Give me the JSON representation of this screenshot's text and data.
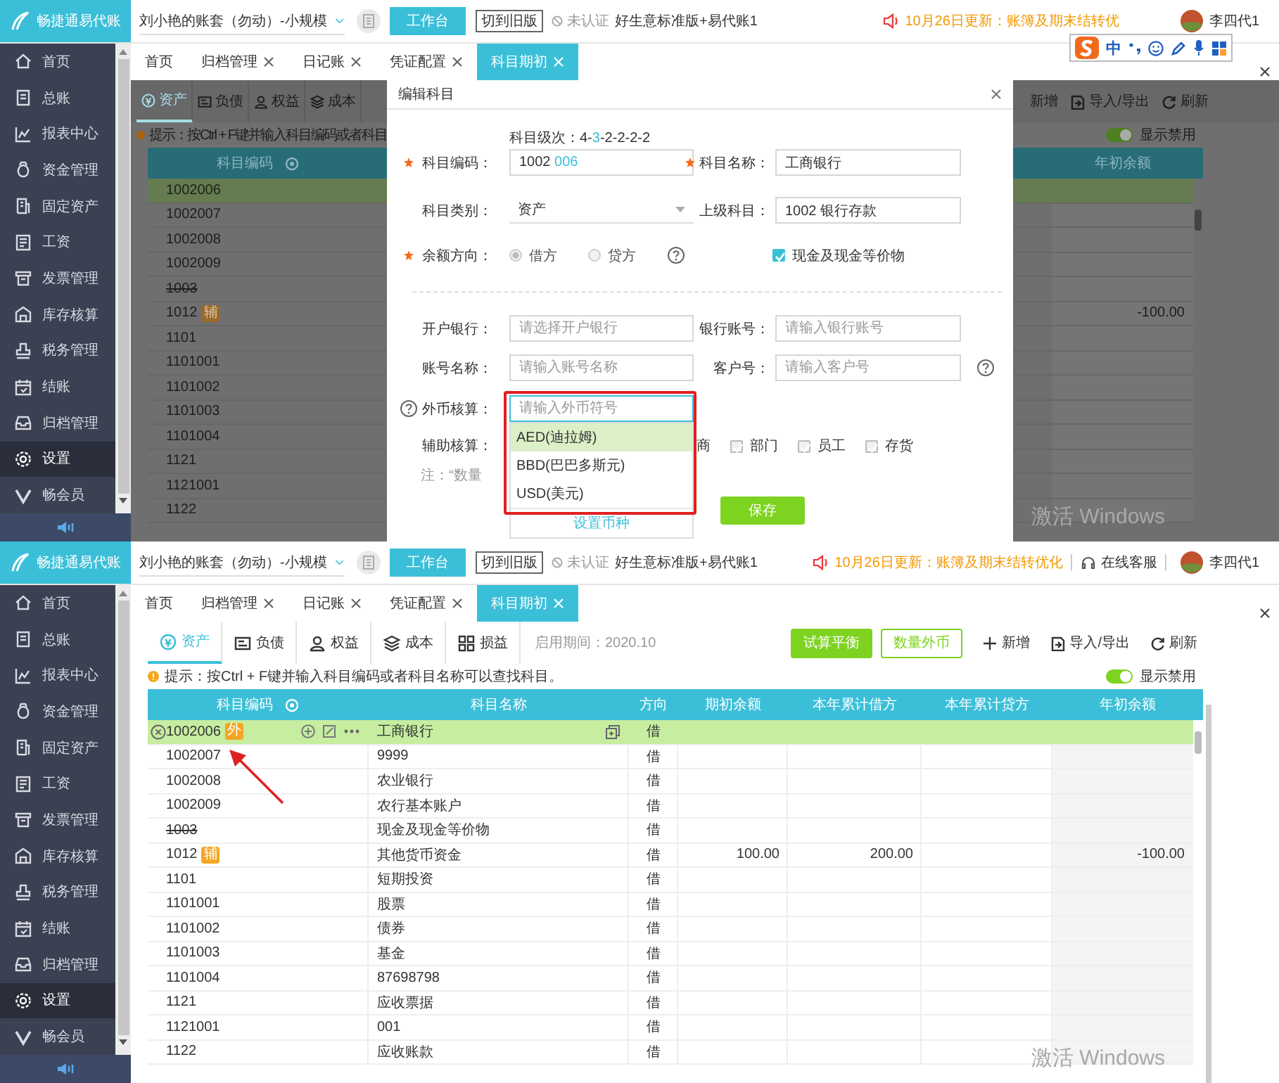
{
  "panels": [
    {
      "kind": "edit",
      "header": {
        "brand": "畅捷通易代账",
        "account": "刘小艳的账套（勿动）-小规模",
        "workbench": "工作台",
        "old_version": "切到旧版",
        "auth": "未认证",
        "edition": "好生意标准版+易代账1",
        "notice": "10月26日更新：账簿及期末结转优",
        "user": "李四代1"
      },
      "sidebar": [
        {
          "label": "首页",
          "selected": false
        },
        {
          "label": "总账",
          "selected": false
        },
        {
          "label": "报表中心",
          "selected": false
        },
        {
          "label": "资金管理",
          "selected": false
        },
        {
          "label": "固定资产",
          "selected": false
        },
        {
          "label": "工资",
          "selected": false
        },
        {
          "label": "发票管理",
          "selected": false
        },
        {
          "label": "库存核算",
          "selected": false
        },
        {
          "label": "税务管理",
          "selected": false
        },
        {
          "label": "结账",
          "selected": false
        },
        {
          "label": "归档管理",
          "selected": false
        },
        {
          "label": "设置",
          "selected": true
        },
        {
          "label": "畅会员",
          "selected": false
        }
      ],
      "tabs": [
        {
          "label": "首页",
          "closable": false,
          "selected": false
        },
        {
          "label": "归档管理",
          "closable": true,
          "selected": false
        },
        {
          "label": "日记账",
          "closable": true,
          "selected": false
        },
        {
          "label": "凭证配置",
          "closable": true,
          "selected": false
        },
        {
          "label": "科目期初",
          "closable": true,
          "selected": true
        }
      ],
      "ime": {
        "mode": "中"
      },
      "subtabs": [
        {
          "label": "资产",
          "selected": true
        },
        {
          "label": "负债",
          "selected": false
        },
        {
          "label": "权益",
          "selected": false
        },
        {
          "label": "成本",
          "selected": false
        }
      ],
      "hint": "提示：按Ctrl + F键并输入科目编码或者科目",
      "code_header": "科目编码",
      "actions": [
        {
          "label": "新增",
          "kind": "plain"
        },
        {
          "label": "导入/导出",
          "kind": "import"
        },
        {
          "label": "刷新",
          "kind": "refresh"
        }
      ],
      "toggle": {
        "label": "显示禁用",
        "on": true
      },
      "year_header": "年初余额",
      "rows": [
        {
          "code": "1002006",
          "selected": true,
          "disabled": false
        },
        {
          "code": "1002007",
          "selected": false,
          "disabled": false
        },
        {
          "code": "1002008",
          "selected": false,
          "disabled": false
        },
        {
          "code": "1002009",
          "selected": false,
          "disabled": false
        },
        {
          "code": "1003",
          "selected": false,
          "disabled": true
        },
        {
          "code": "1012",
          "badge": "辅",
          "selected": false,
          "disabled": false,
          "year_start": "-100.00"
        },
        {
          "code": "1101",
          "selected": false,
          "disabled": false
        },
        {
          "code": "1101001",
          "selected": false,
          "disabled": false
        },
        {
          "code": "1101002",
          "selected": false,
          "disabled": false
        },
        {
          "code": "1101003",
          "selected": false,
          "disabled": false
        },
        {
          "code": "1101004",
          "selected": false,
          "disabled": false
        },
        {
          "code": "1121",
          "selected": false,
          "disabled": false
        },
        {
          "code": "1121001",
          "selected": false,
          "disabled": false
        },
        {
          "code": "1122",
          "selected": false,
          "disabled": false
        }
      ],
      "dialog": {
        "title": "编辑科目",
        "level_hint": [
          {
            "text": "科目级次：4-",
            "highlight": false
          },
          {
            "text": "3",
            "highlight": true
          },
          {
            "text": "-2-2-2-2",
            "highlight": false
          }
        ],
        "code": {
          "label": "科目编码：",
          "required": true,
          "value": [
            {
              "text": "1002 ",
              "highlight": false
            },
            {
              "text": "006",
              "highlight": true
            }
          ]
        },
        "name": {
          "label": "科目名称：",
          "required": true,
          "value": "工商银行"
        },
        "category": {
          "label": "科目类别：",
          "required": false,
          "value": "资产"
        },
        "parent": {
          "label": "上级科目：",
          "required": false,
          "value": "1002 银行存款"
        },
        "direction": {
          "label": "余额方向：",
          "required": true,
          "options": [
            {
              "label": "借方",
              "selected": true
            },
            {
              "label": "贷方",
              "selected": false
            }
          ]
        },
        "cash_equivalent": {
          "label": "现金及现金等价物",
          "checked": true
        },
        "bank": {
          "label": "开户银行：",
          "placeholder": "请选择开户银行"
        },
        "account_no": {
          "label": "银行账号：",
          "placeholder": "请输入银行账号"
        },
        "account_name": {
          "label": "账号名称：",
          "placeholder": "请输入账号名称"
        },
        "customer_no": {
          "label": "客户号：",
          "placeholder": "请输入客户号"
        },
        "currency": {
          "label": "外币核算：",
          "placeholder": "请输入外币符号",
          "footer_link": "设置币种",
          "options": [
            {
              "label": "AED(迪拉姆)",
              "selected": true
            },
            {
              "label": "BBD(巴巴多斯元)",
              "selected": false
            },
            {
              "label": "USD(美元)",
              "selected": false
            }
          ]
        },
        "auxiliary": {
          "label": "辅助核算：",
          "items": [
            {
              "label": "商",
              "kind": "covered"
            },
            {
              "label": "部门",
              "kind": "checkbox",
              "checked": false
            },
            {
              "label": "员工",
              "kind": "checkbox",
              "checked": false
            },
            {
              "label": "存货",
              "kind": "checkbox",
              "checked": false
            }
          ]
        },
        "note": "注：“数量",
        "save": "保存"
      },
      "os_notice": "激活 Windows"
    },
    {
      "kind": "list",
      "header": {
        "brand": "畅捷通易代账",
        "account": "刘小艳的账套（勿动）-小规模",
        "workbench": "工作台",
        "old_version": "切到旧版",
        "auth": "未认证",
        "edition": "好生意标准版+易代账1",
        "notice": "10月26日更新：账簿及期末结转优化",
        "service": "在线客服",
        "user": "李四代1"
      },
      "sidebar": [
        {
          "label": "首页",
          "selected": false
        },
        {
          "label": "总账",
          "selected": false
        },
        {
          "label": "报表中心",
          "selected": false
        },
        {
          "label": "资金管理",
          "selected": false
        },
        {
          "label": "固定资产",
          "selected": false
        },
        {
          "label": "工资",
          "selected": false
        },
        {
          "label": "发票管理",
          "selected": false
        },
        {
          "label": "库存核算",
          "selected": false
        },
        {
          "label": "税务管理",
          "selected": false
        },
        {
          "label": "结账",
          "selected": false
        },
        {
          "label": "归档管理",
          "selected": false
        },
        {
          "label": "设置",
          "selected": true
        },
        {
          "label": "畅会员",
          "selected": false
        }
      ],
      "tabs": [
        {
          "label": "首页",
          "closable": false,
          "selected": false
        },
        {
          "label": "归档管理",
          "closable": true,
          "selected": false
        },
        {
          "label": "日记账",
          "closable": true,
          "selected": false
        },
        {
          "label": "凭证配置",
          "closable": true,
          "selected": false
        },
        {
          "label": "科目期初",
          "closable": true,
          "selected": true
        }
      ],
      "subtabs": [
        {
          "label": "资产",
          "selected": true
        },
        {
          "label": "负债",
          "selected": false
        },
        {
          "label": "权益",
          "selected": false
        },
        {
          "label": "成本",
          "selected": false
        },
        {
          "label": "损益",
          "selected": false
        }
      ],
      "period": "启用期间：2020.10",
      "buttons": [
        {
          "label": "试算平衡",
          "kind": "primary"
        },
        {
          "label": "数量外币",
          "kind": "outline"
        }
      ],
      "actions": [
        {
          "label": "新增",
          "kind": "add"
        },
        {
          "label": "导入/导出",
          "kind": "import"
        },
        {
          "label": "刷新",
          "kind": "refresh"
        }
      ],
      "hint": "提示：按Ctrl + F键并输入科目编码或者科目名称可以查找科目。",
      "toggle": {
        "label": "显示禁用",
        "on": true
      },
      "columns": [
        "科目编码",
        "科目名称",
        "方向",
        "期初余额",
        "本年累计借方",
        "本年累计贷方",
        "年初余额"
      ],
      "rows": [
        {
          "code": "1002006",
          "badge": "外",
          "name": "工商银行",
          "direction": "借",
          "selected": true,
          "disabled": false
        },
        {
          "code": "1002007",
          "name": "9999",
          "direction": "借",
          "selected": false,
          "disabled": false
        },
        {
          "code": "1002008",
          "name": "农业银行",
          "direction": "借",
          "selected": false,
          "disabled": false
        },
        {
          "code": "1002009",
          "name": "农行基本账户",
          "direction": "借",
          "selected": false,
          "disabled": false
        },
        {
          "code": "1003",
          "name": "现金及现金等价物",
          "direction": "借",
          "selected": false,
          "disabled": true
        },
        {
          "code": "1012",
          "badge": "辅",
          "name": "其他货币资金",
          "direction": "借",
          "opening": "100.00",
          "debit": "200.00",
          "year_start": "-100.00",
          "selected": false,
          "disabled": false
        },
        {
          "code": "1101",
          "name": "短期投资",
          "direction": "借",
          "selected": false,
          "disabled": false
        },
        {
          "code": "1101001",
          "name": "股票",
          "direction": "借",
          "selected": false,
          "disabled": false
        },
        {
          "code": "1101002",
          "name": "债券",
          "direction": "借",
          "selected": false,
          "disabled": false
        },
        {
          "code": "1101003",
          "name": "基金",
          "direction": "借",
          "selected": false,
          "disabled": false
        },
        {
          "code": "1101004",
          "name": "87698798",
          "direction": "借",
          "selected": false,
          "disabled": false
        },
        {
          "code": "1121",
          "name": "应收票据",
          "direction": "借",
          "selected": false,
          "disabled": false
        },
        {
          "code": "1121001",
          "name": "001",
          "direction": "借",
          "selected": false,
          "disabled": false
        },
        {
          "code": "1122",
          "name": "应收账款",
          "direction": "借",
          "selected": false,
          "disabled": false
        }
      ],
      "os_notice": "激活 Windows"
    }
  ]
}
